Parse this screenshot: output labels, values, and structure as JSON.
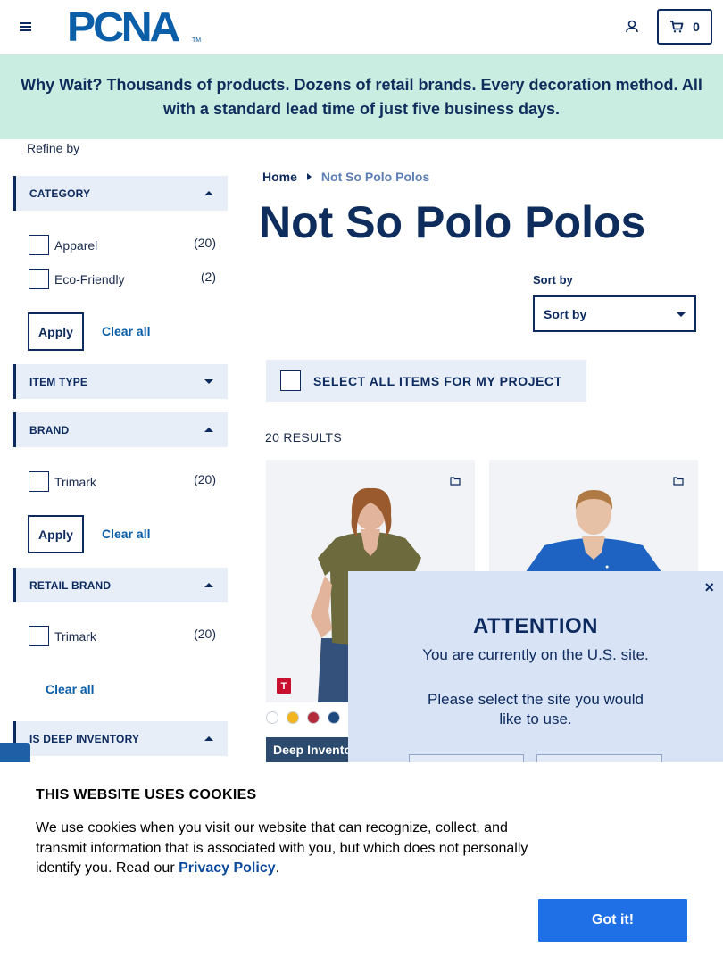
{
  "header": {
    "logo_text": "PCNA",
    "logo_tm": "TM",
    "cart_count": "0"
  },
  "banner": {
    "text": "Why Wait? Thousands of products. Dozens of retail brands. Every decoration method. All with a standard lead time of just five business days."
  },
  "sidebar": {
    "refine_label": "Refine by",
    "facets": {
      "category": {
        "label": "CATEGORY",
        "options": [
          {
            "name": "Apparel",
            "count": "(20)"
          },
          {
            "name": "Eco-Friendly",
            "count": "(2)"
          }
        ],
        "apply_label": "Apply",
        "clear_label": "Clear all"
      },
      "item_type": {
        "label": "ITEM TYPE"
      },
      "brand": {
        "label": "BRAND",
        "options": [
          {
            "name": "Trimark",
            "count": "(20)"
          }
        ],
        "apply_label": "Apply",
        "clear_label": "Clear all"
      },
      "retail_brand": {
        "label": "RETAIL BRAND",
        "options": [
          {
            "name": "Trimark",
            "count": "(20)"
          }
        ],
        "clear_label": "Clear all"
      },
      "deep_inventory": {
        "label": "IS DEEP INVENTORY"
      }
    }
  },
  "main": {
    "breadcrumb": {
      "home": "Home",
      "current": "Not So Polo Polos"
    },
    "title": "Not So Polo Polos",
    "sort": {
      "label": "Sort by",
      "selected": "Sort by"
    },
    "select_all_label": "SELECT ALL ITEMS FOR MY PROJECT",
    "results_text": "20 RESULTS",
    "products": [
      {
        "brand_badge": "T",
        "swatches": [
          "#ffffff",
          "#f2b51e",
          "#b22c3a",
          "#1f4a80"
        ],
        "tag": "Deep Inventory"
      },
      {
        "tag": ""
      }
    ]
  },
  "attention": {
    "close": "×",
    "title": "ATTENTION",
    "line1": "You are currently on the U.S. site.",
    "line2": "Please select the site you would like to use."
  },
  "cookie": {
    "title": "THIS WEBSITE USES COOKIES",
    "text": "We use cookies when you visit our website that can recognize, collect, and transmit information that is associated with you, but which does not personally identify you. Read our ",
    "privacy_link": "Privacy Policy",
    "period": ".",
    "accept_label": "Got it!"
  },
  "colors": {
    "navy": "#0d2a5e",
    "brand_blue": "#0b5ea8",
    "banner_bg": "#c9ede0",
    "facet_bg": "#e7eef7",
    "modal_bg": "#d8e3f6",
    "cookie_button": "#1f6fe6"
  }
}
